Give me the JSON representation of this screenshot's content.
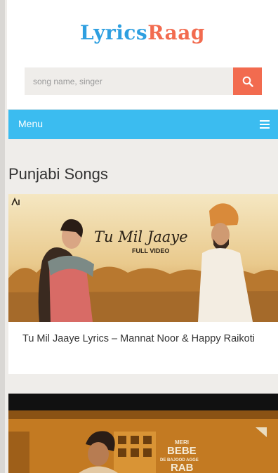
{
  "header": {
    "logo_part1": "Lyrics",
    "logo_part2": "Raag",
    "search_placeholder": "song name, singer"
  },
  "nav": {
    "menu_label": "Menu"
  },
  "section": {
    "title": "Punjabi Songs"
  },
  "posts": [
    {
      "title": "Tu Mil Jaaye Lyrics – Mannat Noor & Happy Raikoti",
      "thumb_title": "Tu Mil Jaaye",
      "thumb_subtitle": "FULL VIDEO"
    },
    {
      "thumb_line1": "MERI",
      "thumb_line2": "BEBE",
      "thumb_line3": "DE BAJOOD AGGE",
      "thumb_line4": "RAB"
    }
  ],
  "colors": {
    "brand_blue": "#2e9fe0",
    "brand_orange": "#f26b4f",
    "menu_blue": "#3bbcf0"
  }
}
